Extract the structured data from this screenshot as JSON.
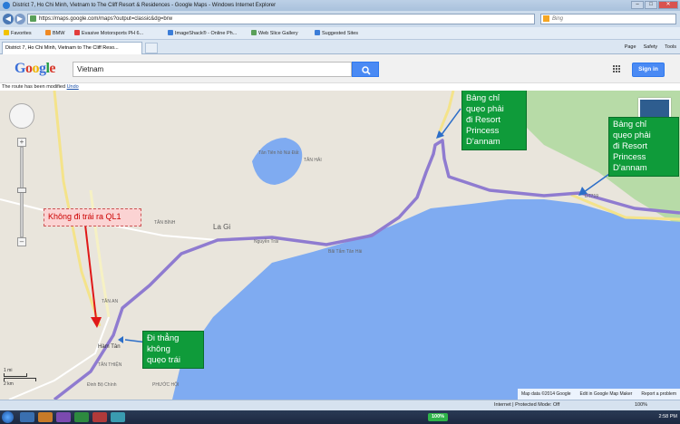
{
  "window": {
    "title": "District 7, Ho Chi Minh, Vietnam to The Cliff Resort & Residences - Google Maps - Windows Internet Explorer"
  },
  "addressbar": {
    "url": "https://maps.google.com/maps?output=classic&dg=brw",
    "search_placeholder": "Bing"
  },
  "favorites": {
    "items": [
      {
        "label": "Favorites",
        "color": "#f2c200"
      },
      {
        "label": "BMW",
        "color": "#f08a24"
      },
      {
        "label": "Evasive Motorsports  PH 6...",
        "color": "#e23d3d"
      },
      {
        "label": "ImageShack® - Online Ph...",
        "color": "#3b7dd8"
      },
      {
        "label": "Web Slice Gallery",
        "color": "#5aa05a"
      },
      {
        "label": "Suggested Sites",
        "color": "#3b7dd8"
      }
    ]
  },
  "tabs": {
    "active": "District 7, Ho Chi Minh, Vietnam to The Cliff Reso...",
    "tools": [
      "Page",
      "Safety",
      "Tools"
    ]
  },
  "gmaps": {
    "logo": "Google",
    "search_value": "Vietnam",
    "signin": "Sign in",
    "notice": "The route has been modified",
    "undo": "Undo"
  },
  "map": {
    "labels": {
      "la_gi": "La Gi",
      "tan_binh": "TÂN BÌNH",
      "tan_an": "TÂN AN",
      "ham_tan": "Hàm Tân",
      "tan_thien": "TÂN THIỆN",
      "tan_hai": "TÂN HẢI",
      "dai_tan_hai": "Bãi Tắm Tân Hải",
      "lake": "Tân Tiên hồ Núi Đất",
      "dinh_bo_chinh": "Đinh Bộ Chính",
      "phuoc_hoi": "PHƯỚC HỘI",
      "road_dt719": "DT719",
      "road_nguyen": "Nguyễn Trãi"
    },
    "callouts": {
      "top_center": [
        "Bảng chỉ",
        "quẹo phải",
        "đi Resort",
        "Princess",
        "D'annam"
      ],
      "right": [
        "Bảng chỉ",
        "quẹo phải",
        "đi Resort",
        "Princess",
        "D'annam"
      ],
      "left_warning": "Không đi trái ra QL1",
      "bottom": [
        "Đi thẳng",
        "không",
        "quẹo trái"
      ]
    },
    "scale": {
      "mi": "1 mi",
      "km": "2 km"
    },
    "attribution": {
      "data": "Map data ©2014 Google",
      "edit": "Edit in Google Map Maker",
      "report": "Report a problem"
    },
    "colors": {
      "sea": "#7fabf1",
      "land": "#e9e5dc",
      "green": "#b7dba7",
      "route": "#8f7bd0",
      "callout_green": "#0f9b3a",
      "arrow_red": "#e01818",
      "arrow_blue": "#2c6ec8"
    }
  },
  "statusbar": {
    "zone": "Internet | Protected Mode: Off",
    "zoom": "100%"
  },
  "taskbar": {
    "percent": "100%",
    "time": "2:58 PM"
  }
}
